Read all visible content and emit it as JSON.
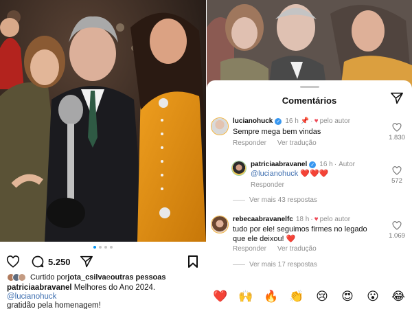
{
  "post": {
    "like_count": "5.250",
    "liked_by_prefix": "Curtido por ",
    "liked_by_user": "jota_csilva",
    "liked_by_joiner": " e ",
    "liked_by_rest": "outras pessoas",
    "caption_user": "patriciaabravanel",
    "caption_text": " Melhores do Ano 2024. ",
    "caption_mention": "@lucianohuck",
    "caption_line2": "gratidão pela homenagem!",
    "carousel_count": 4,
    "carousel_active": 0
  },
  "sheet": {
    "title": "Comentários"
  },
  "comments": [
    {
      "user": "lucianohuck",
      "time": "16 h",
      "author_label": "pelo autor",
      "text": "Sempre mega bem vindas",
      "reply_label": "Responder",
      "translate_label": "Ver tradução",
      "likes": "1.830"
    },
    {
      "user": "patriciaabravanel",
      "time": "16 h",
      "author_label": "Autor",
      "mention": "@lucianohuck",
      "text": " ❤️❤️❤️",
      "reply_label": "Responder",
      "likes": "572"
    },
    {
      "more_label": "Ver mais 43 respostas"
    },
    {
      "user": "rebecaabravanelfc",
      "time": "18 h",
      "author_label": "pelo autor",
      "text": "tudo por ele! seguimos firmes no legado que ele deixou! ❤️",
      "reply_label": "Responder",
      "translate_label": "Ver tradução",
      "likes": "1.069"
    },
    {
      "more_label": "Ver mais 17 respostas"
    }
  ],
  "emoji_bar": [
    "❤️",
    "🙌",
    "🔥",
    "👏",
    "😢",
    "😍",
    "😮",
    "😂"
  ],
  "colors": {
    "mention": "#3f6fb0",
    "heart_red": "#ed4956",
    "verified": "#3897f0",
    "carousel_active": "#0095f6"
  }
}
